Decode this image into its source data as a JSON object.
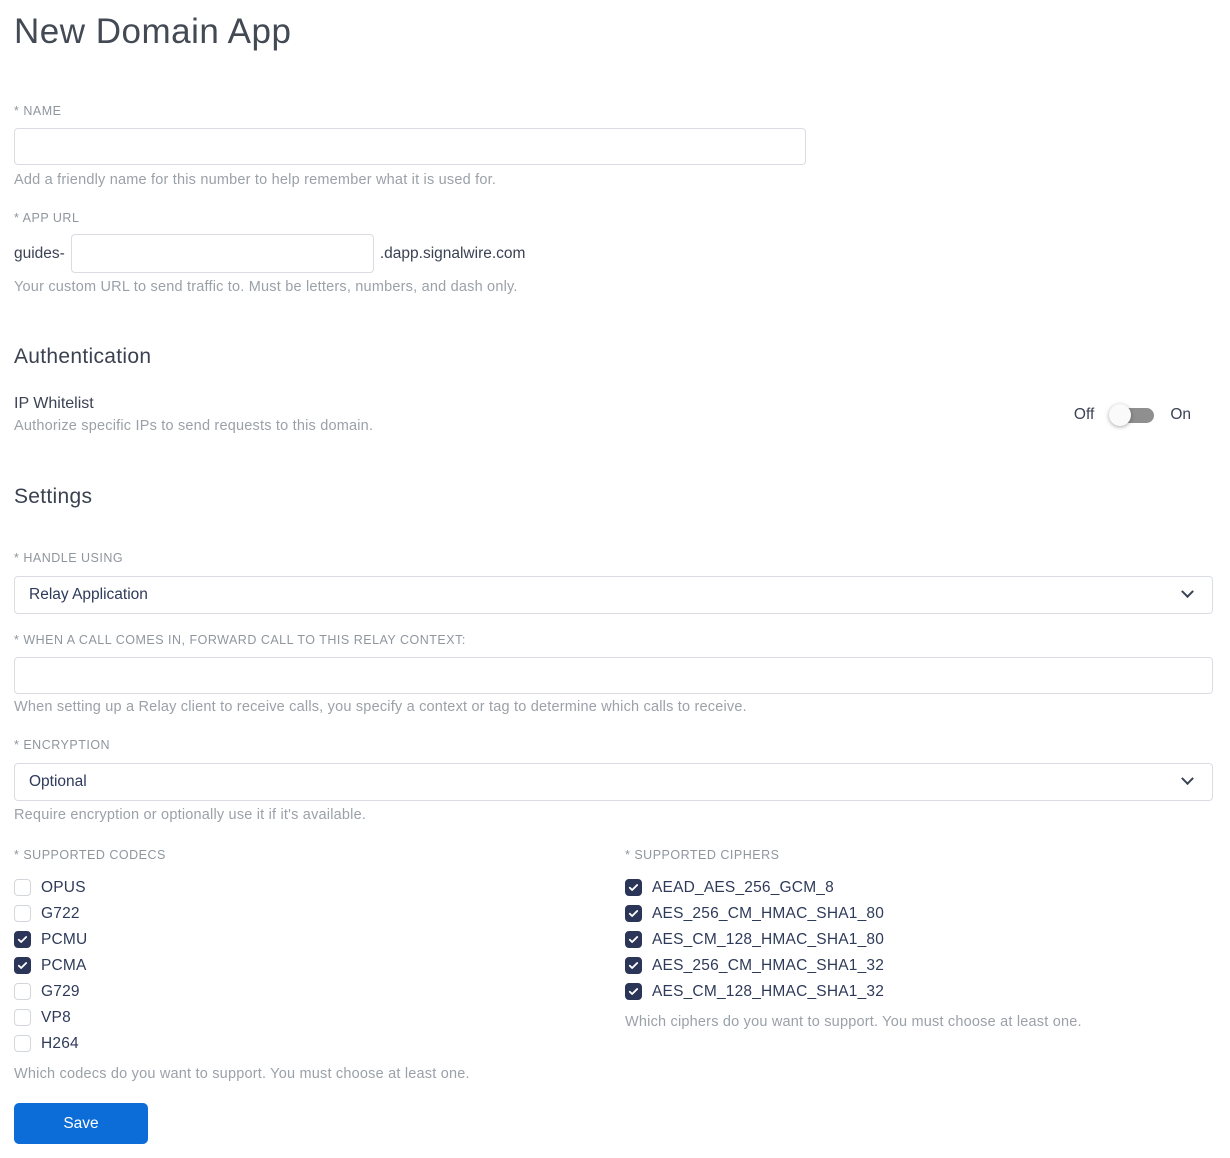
{
  "page": {
    "title": "New Domain App"
  },
  "fields": {
    "name": {
      "label": "* NAME",
      "value": "",
      "helper": "Add a friendly name for this number to help remember what it is used for."
    },
    "app_url": {
      "label": "* APP URL",
      "prefix": "guides-",
      "value": "",
      "suffix": ".dapp.signalwire.com",
      "helper": "Your custom URL to send traffic to. Must be letters, numbers, and dash only."
    }
  },
  "authentication": {
    "heading": "Authentication",
    "ip_whitelist": {
      "label": "IP Whitelist",
      "helper": "Authorize specific IPs to send requests to this domain.",
      "off_label": "Off",
      "on_label": "On",
      "enabled": false
    }
  },
  "settings": {
    "heading": "Settings",
    "handle_using": {
      "label": "* HANDLE USING",
      "value": "Relay Application"
    },
    "relay_context": {
      "label": "* WHEN A CALL COMES IN, FORWARD CALL TO THIS RELAY CONTEXT:",
      "value": "",
      "helper": "When setting up a Relay client to receive calls, you specify a context or tag to determine which calls to receive."
    },
    "encryption": {
      "label": "* ENCRYPTION",
      "value": "Optional",
      "helper": "Require encryption or optionally use it if it's available."
    },
    "codecs": {
      "label": "* SUPPORTED CODECS",
      "helper": "Which codecs do you want to support. You must choose at least one.",
      "options": [
        {
          "label": "OPUS",
          "checked": false
        },
        {
          "label": "G722",
          "checked": false
        },
        {
          "label": "PCMU",
          "checked": true
        },
        {
          "label": "PCMA",
          "checked": true
        },
        {
          "label": "G729",
          "checked": false
        },
        {
          "label": "VP8",
          "checked": false
        },
        {
          "label": "H264",
          "checked": false
        }
      ]
    },
    "ciphers": {
      "label": "* SUPPORTED CIPHERS",
      "helper": "Which ciphers do you want to support. You must choose at least one.",
      "options": [
        {
          "label": "AEAD_AES_256_GCM_8",
          "checked": true
        },
        {
          "label": "AES_256_CM_HMAC_SHA1_80",
          "checked": true
        },
        {
          "label": "AES_CM_128_HMAC_SHA1_80",
          "checked": true
        },
        {
          "label": "AES_256_CM_HMAC_SHA1_32",
          "checked": true
        },
        {
          "label": "AES_CM_128_HMAC_SHA1_32",
          "checked": true
        }
      ]
    }
  },
  "actions": {
    "save_label": "Save"
  },
  "icons": {
    "chevron": "chevron-down-icon",
    "checkmark": "checkmark-icon"
  },
  "colors": {
    "accent_blue": "#0d6dd8",
    "checkbox_checked_bg": "#2b3557",
    "toggle_track": "#8f8f8f",
    "toggle_knob": "#fafafa",
    "input_border": "#d9dde3",
    "label_gray": "#8f969e",
    "helper_gray": "#9ba1a9",
    "text_navy": "#2e3a59",
    "heading_color": "#3a4150"
  }
}
